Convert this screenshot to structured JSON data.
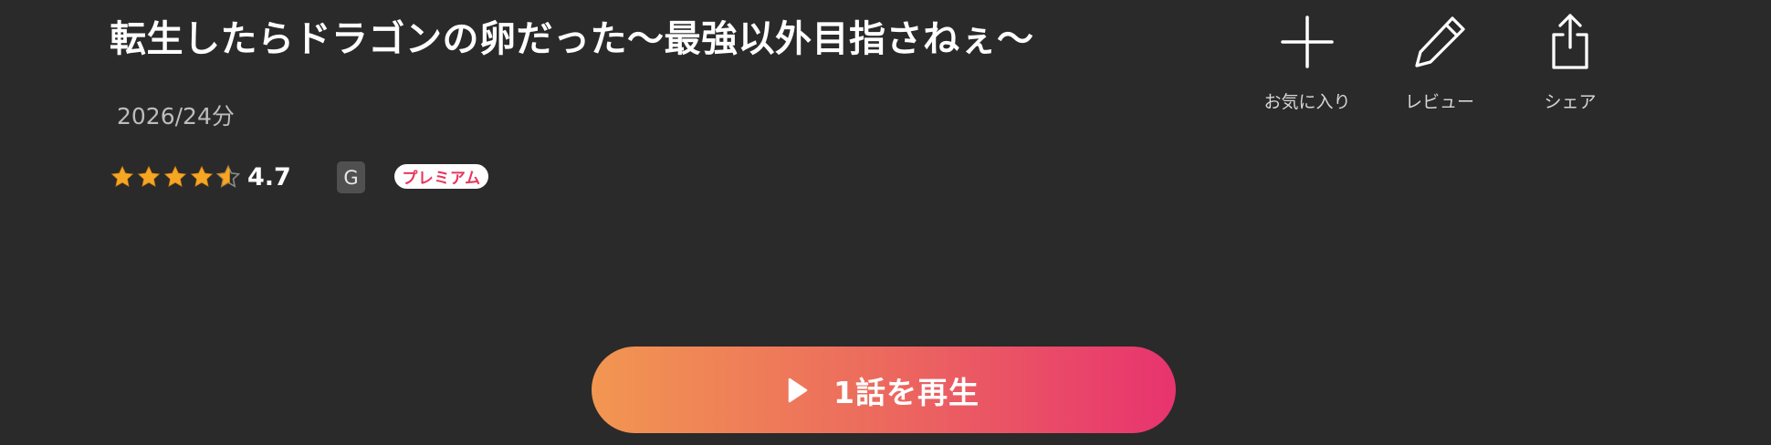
{
  "title": "転生したらドラゴンの卵だった〜最強以外目指さねぇ〜",
  "meta": "2026/24分",
  "rating": {
    "value": "4.7",
    "stars": 4.7,
    "max_stars": 5
  },
  "age_rating": "G",
  "premium_label": "プレミアム",
  "actions": {
    "favorite_label": "お気に入り",
    "review_label": "レビュー",
    "share_label": "シェア"
  },
  "play_label": "1話を再生",
  "colors": {
    "background": "#2a2a2a",
    "star": "#f5a623",
    "premium_text": "#e8365f",
    "play_gradient_start": "#f29651",
    "play_gradient_end": "#e8336f"
  }
}
